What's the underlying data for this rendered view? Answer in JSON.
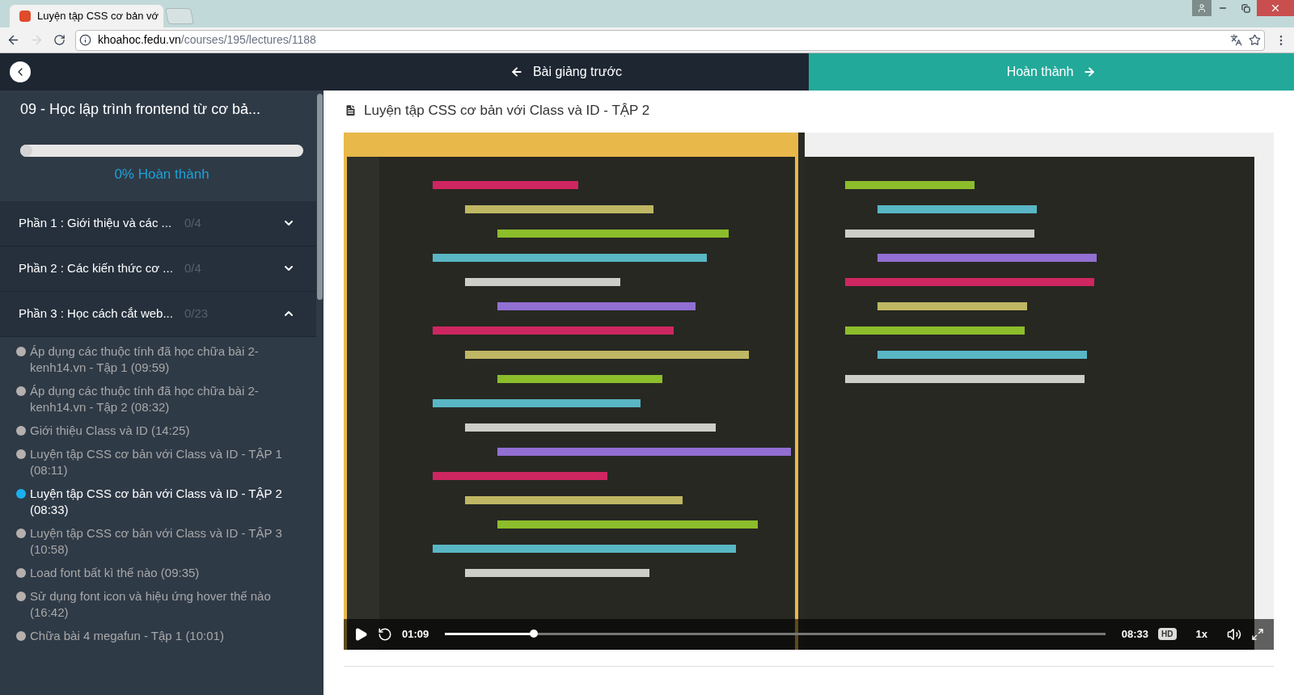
{
  "browser": {
    "tabs": [
      {
        "title": "Luyện tập CSS cơ bản vớ",
        "selected": true
      }
    ],
    "address": {
      "host": "khoahoc.fedu.vn",
      "path": "/courses/195/lectures/1188"
    }
  },
  "sidebar": {
    "course_title": "09 - Học lập trình frontend từ cơ bả...",
    "progress": {
      "level": 0,
      "label": "0% Hoàn thành"
    },
    "sections": [
      {
        "title": "Phần 1 : Giới thiệu và các ...",
        "count": "0/4",
        "expanded": false
      },
      {
        "title": "Phần 2 : Các kiến thức cơ ...",
        "count": "0/4",
        "expanded": false
      },
      {
        "title": "Phần 3 : Học cách cắt web...",
        "count": "0/23",
        "expanded": true
      }
    ],
    "lessons": [
      {
        "title": "Áp dụng các thuộc tính đã học chữa bài 2-kenh14.vn - Tập 1 (09:59)",
        "selected": false
      },
      {
        "title": "Áp dụng các thuộc tính đã học chữa bài 2-kenh14.vn - Tập 2 (08:32)",
        "selected": false
      },
      {
        "title": "Giới thiệu Class và ID (14:25)",
        "selected": false
      },
      {
        "title": "Luyện tập CSS cơ bản với Class và ID - TẬP 1 (08:11)",
        "selected": false
      },
      {
        "title": "Luyện tập CSS cơ bản với Class và ID - TẬP 2 (08:33)",
        "selected": true
      },
      {
        "title": "Luyện tập CSS cơ bản với Class và ID - TẬP 3 (10:58)",
        "selected": false
      },
      {
        "title": "Load font bất kì thế nào (09:35)",
        "selected": false
      },
      {
        "title": "Sử dụng font icon và hiệu ứng hover thế nào (16:42)",
        "selected": false
      },
      {
        "title": "Chữa bài 4 megafun - Tập 1 (10:01)",
        "selected": false
      }
    ]
  },
  "nav": {
    "previous": "Bài giảng trước",
    "complete": "Hoàn thành"
  },
  "lecture": {
    "title": "Luyện tập CSS cơ bản với Class và ID - TẬP 2",
    "video": {
      "kind": "picture",
      "elapsed": "01:09",
      "duration": "08:33",
      "level": 0.134,
      "quality": "HD",
      "speed": "1x"
    }
  }
}
